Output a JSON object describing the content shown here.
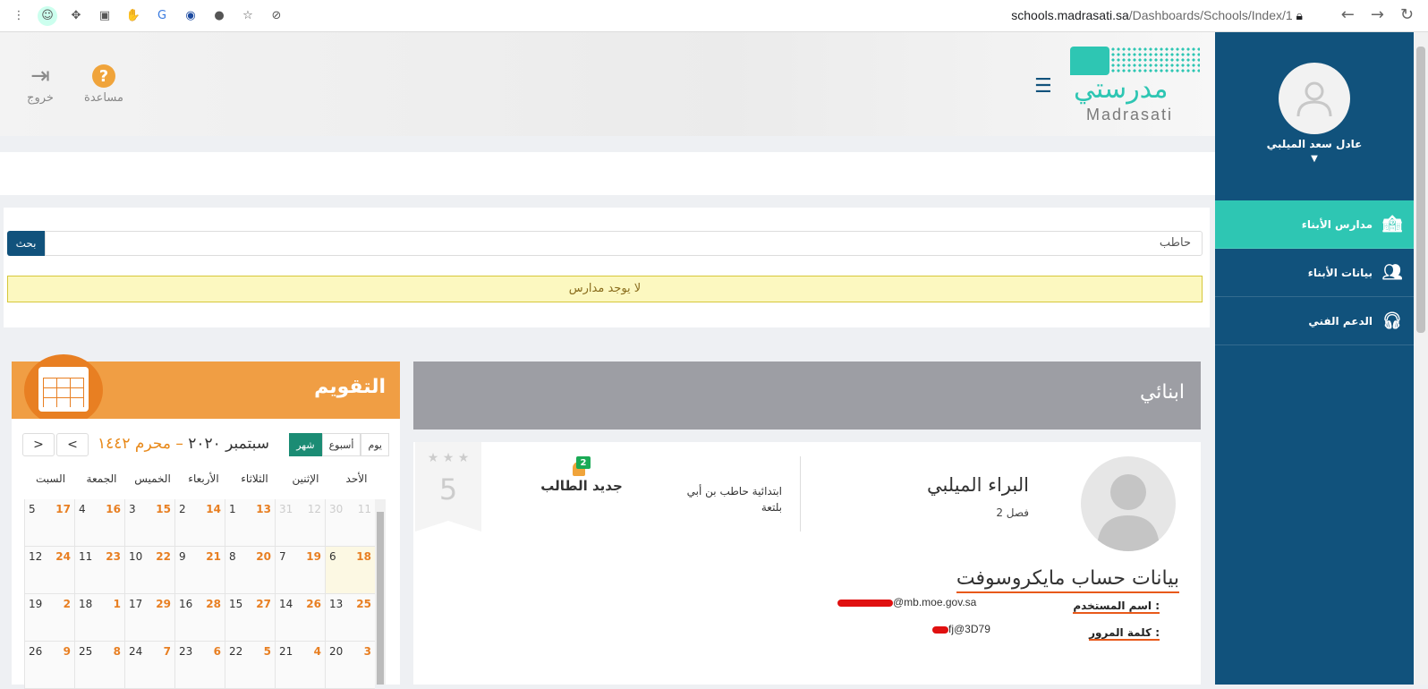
{
  "browser": {
    "url_host": "schools.madrasati.sa",
    "url_path": "/Dashboards/Schools/Index/1"
  },
  "sidebar": {
    "user_name": "عادل سعد الميلبي",
    "items": [
      {
        "label": "مدارس الأبناء",
        "icon": "school-building-icon",
        "active": true
      },
      {
        "label": "بيانات الأبناء",
        "icon": "children-icon",
        "active": false
      },
      {
        "label": "الدعم الفني",
        "icon": "headset-icon",
        "active": false
      }
    ]
  },
  "header": {
    "logo_ar": "مدرستي",
    "logo_en": "Madrasati",
    "help_label": "مساعدة",
    "exit_label": "خروج"
  },
  "search": {
    "value": "حاطب",
    "button_label": "بحث",
    "no_results": "لا يوجد مدارس"
  },
  "kids": {
    "title": "ابنائي",
    "card": {
      "name": "البراء الميلبي",
      "class": "فصل 2",
      "school": "ابتدائية حاطب بن أبي بلتعة",
      "new_student": "جديد الطالب",
      "badge": "2",
      "rating": "5",
      "ms_title": "بيانات حساب مايكروسوفت",
      "username_label": "اسم المستخدم :",
      "username_value": "@mb.moe.gov.sa",
      "password_label": "كلمة المرور :",
      "password_value": "fj@3D79"
    }
  },
  "calendar": {
    "title": "التقويم",
    "hijri_range": "محرم ١٤٤٢",
    "dash": " – ",
    "greg_range": "سبتمبر ٢٠٢٠",
    "views": {
      "day": "يوم",
      "week": "أسبوع",
      "month": "شهر"
    },
    "prev": "<",
    "next": ">",
    "weekdays": [
      "الأحد",
      "الإثنين",
      "الثلاثاء",
      "الأربعاء",
      "الخميس",
      "الجمعة",
      "السبت"
    ],
    "rows": [
      [
        {
          "g": "30",
          "h": "11",
          "dim": true
        },
        {
          "g": "31",
          "h": "12",
          "dim": true
        },
        {
          "g": "1",
          "h": "13"
        },
        {
          "g": "2",
          "h": "14"
        },
        {
          "g": "3",
          "h": "15"
        },
        {
          "g": "4",
          "h": "16"
        },
        {
          "g": "5",
          "h": "17"
        }
      ],
      [
        {
          "g": "6",
          "h": "18",
          "today": true
        },
        {
          "g": "7",
          "h": "19"
        },
        {
          "g": "8",
          "h": "20"
        },
        {
          "g": "9",
          "h": "21"
        },
        {
          "g": "10",
          "h": "22"
        },
        {
          "g": "11",
          "h": "23"
        },
        {
          "g": "12",
          "h": "24"
        }
      ],
      [
        {
          "g": "13",
          "h": "25"
        },
        {
          "g": "14",
          "h": "26"
        },
        {
          "g": "15",
          "h": "27"
        },
        {
          "g": "16",
          "h": "28"
        },
        {
          "g": "17",
          "h": "29"
        },
        {
          "g": "18",
          "h": "1"
        },
        {
          "g": "19",
          "h": "2"
        }
      ],
      [
        {
          "g": "20",
          "h": "3"
        },
        {
          "g": "21",
          "h": "4"
        },
        {
          "g": "22",
          "h": "5"
        },
        {
          "g": "23",
          "h": "6"
        },
        {
          "g": "24",
          "h": "7"
        },
        {
          "g": "25",
          "h": "8"
        },
        {
          "g": "26",
          "h": "9"
        }
      ]
    ]
  },
  "colors": {
    "sidebar": "#11527c",
    "accent": "#2ec6b3",
    "calendar_orange": "#f09e44",
    "hijri_orange": "#e87f22"
  }
}
